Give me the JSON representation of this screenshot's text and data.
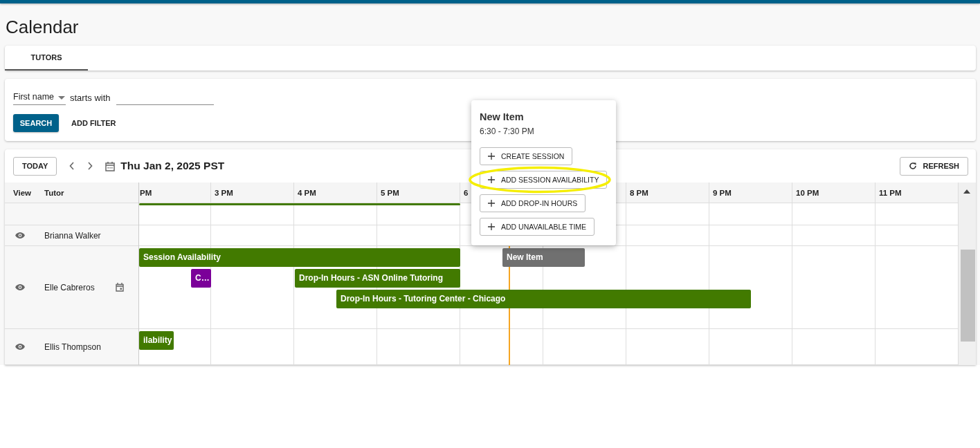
{
  "page_title": "Calendar",
  "tabs": [
    {
      "label": "TUTORS",
      "selected": true
    }
  ],
  "filter": {
    "field": "First name",
    "operator": "starts with",
    "search_button": "SEARCH",
    "add_filter": "ADD FILTER"
  },
  "toolbar": {
    "today": "TODAY",
    "date": "Thu Jan 2, 2025 PST",
    "refresh": "REFRESH"
  },
  "table": {
    "columns": [
      "View",
      "Tutor"
    ],
    "hours": [
      {
        "label": "PM"
      },
      {
        "label": "3 PM"
      },
      {
        "label": "4 PM"
      },
      {
        "label": "5 PM"
      },
      {
        "label": "6"
      },
      {
        "label": "8 PM"
      },
      {
        "label": "9 PM"
      },
      {
        "label": "10 PM"
      },
      {
        "label": "11 PM"
      }
    ],
    "rows": [
      {
        "events": [
          {
            "color": "#427a00"
          }
        ]
      },
      {
        "name": "Brianna Walker",
        "view": true,
        "events": []
      },
      {
        "name": "Elle Cabreros",
        "view": true,
        "calendar": true,
        "events": [
          {
            "label": "Session Availability",
            "color": "#427a00"
          },
          {
            "label": "New Item",
            "color": "#707070"
          },
          {
            "label": "C…",
            "color": "#7b0099"
          },
          {
            "label": "Drop-In Hours - ASN Online Tutoring",
            "color": "#427a00"
          },
          {
            "label": "Drop-In Hours - Tutoring Center - Chicago",
            "color": "#427a00"
          }
        ]
      },
      {
        "name": "Ellis Thompson",
        "view": true,
        "events": [
          {
            "label": "ilability",
            "color": "#427a00"
          }
        ]
      }
    ]
  },
  "popup": {
    "title": "New Item",
    "time": "6:30 - 7:30 PM",
    "actions": [
      {
        "label": "CREATE SESSION",
        "annotated": false
      },
      {
        "label": "ADD SESSION AVAILABILITY",
        "annotated": true
      },
      {
        "label": "ADD DROP-IN HOURS",
        "annotated": false
      },
      {
        "label": "ADD UNAVAILABLE TIME",
        "annotated": false
      }
    ]
  }
}
